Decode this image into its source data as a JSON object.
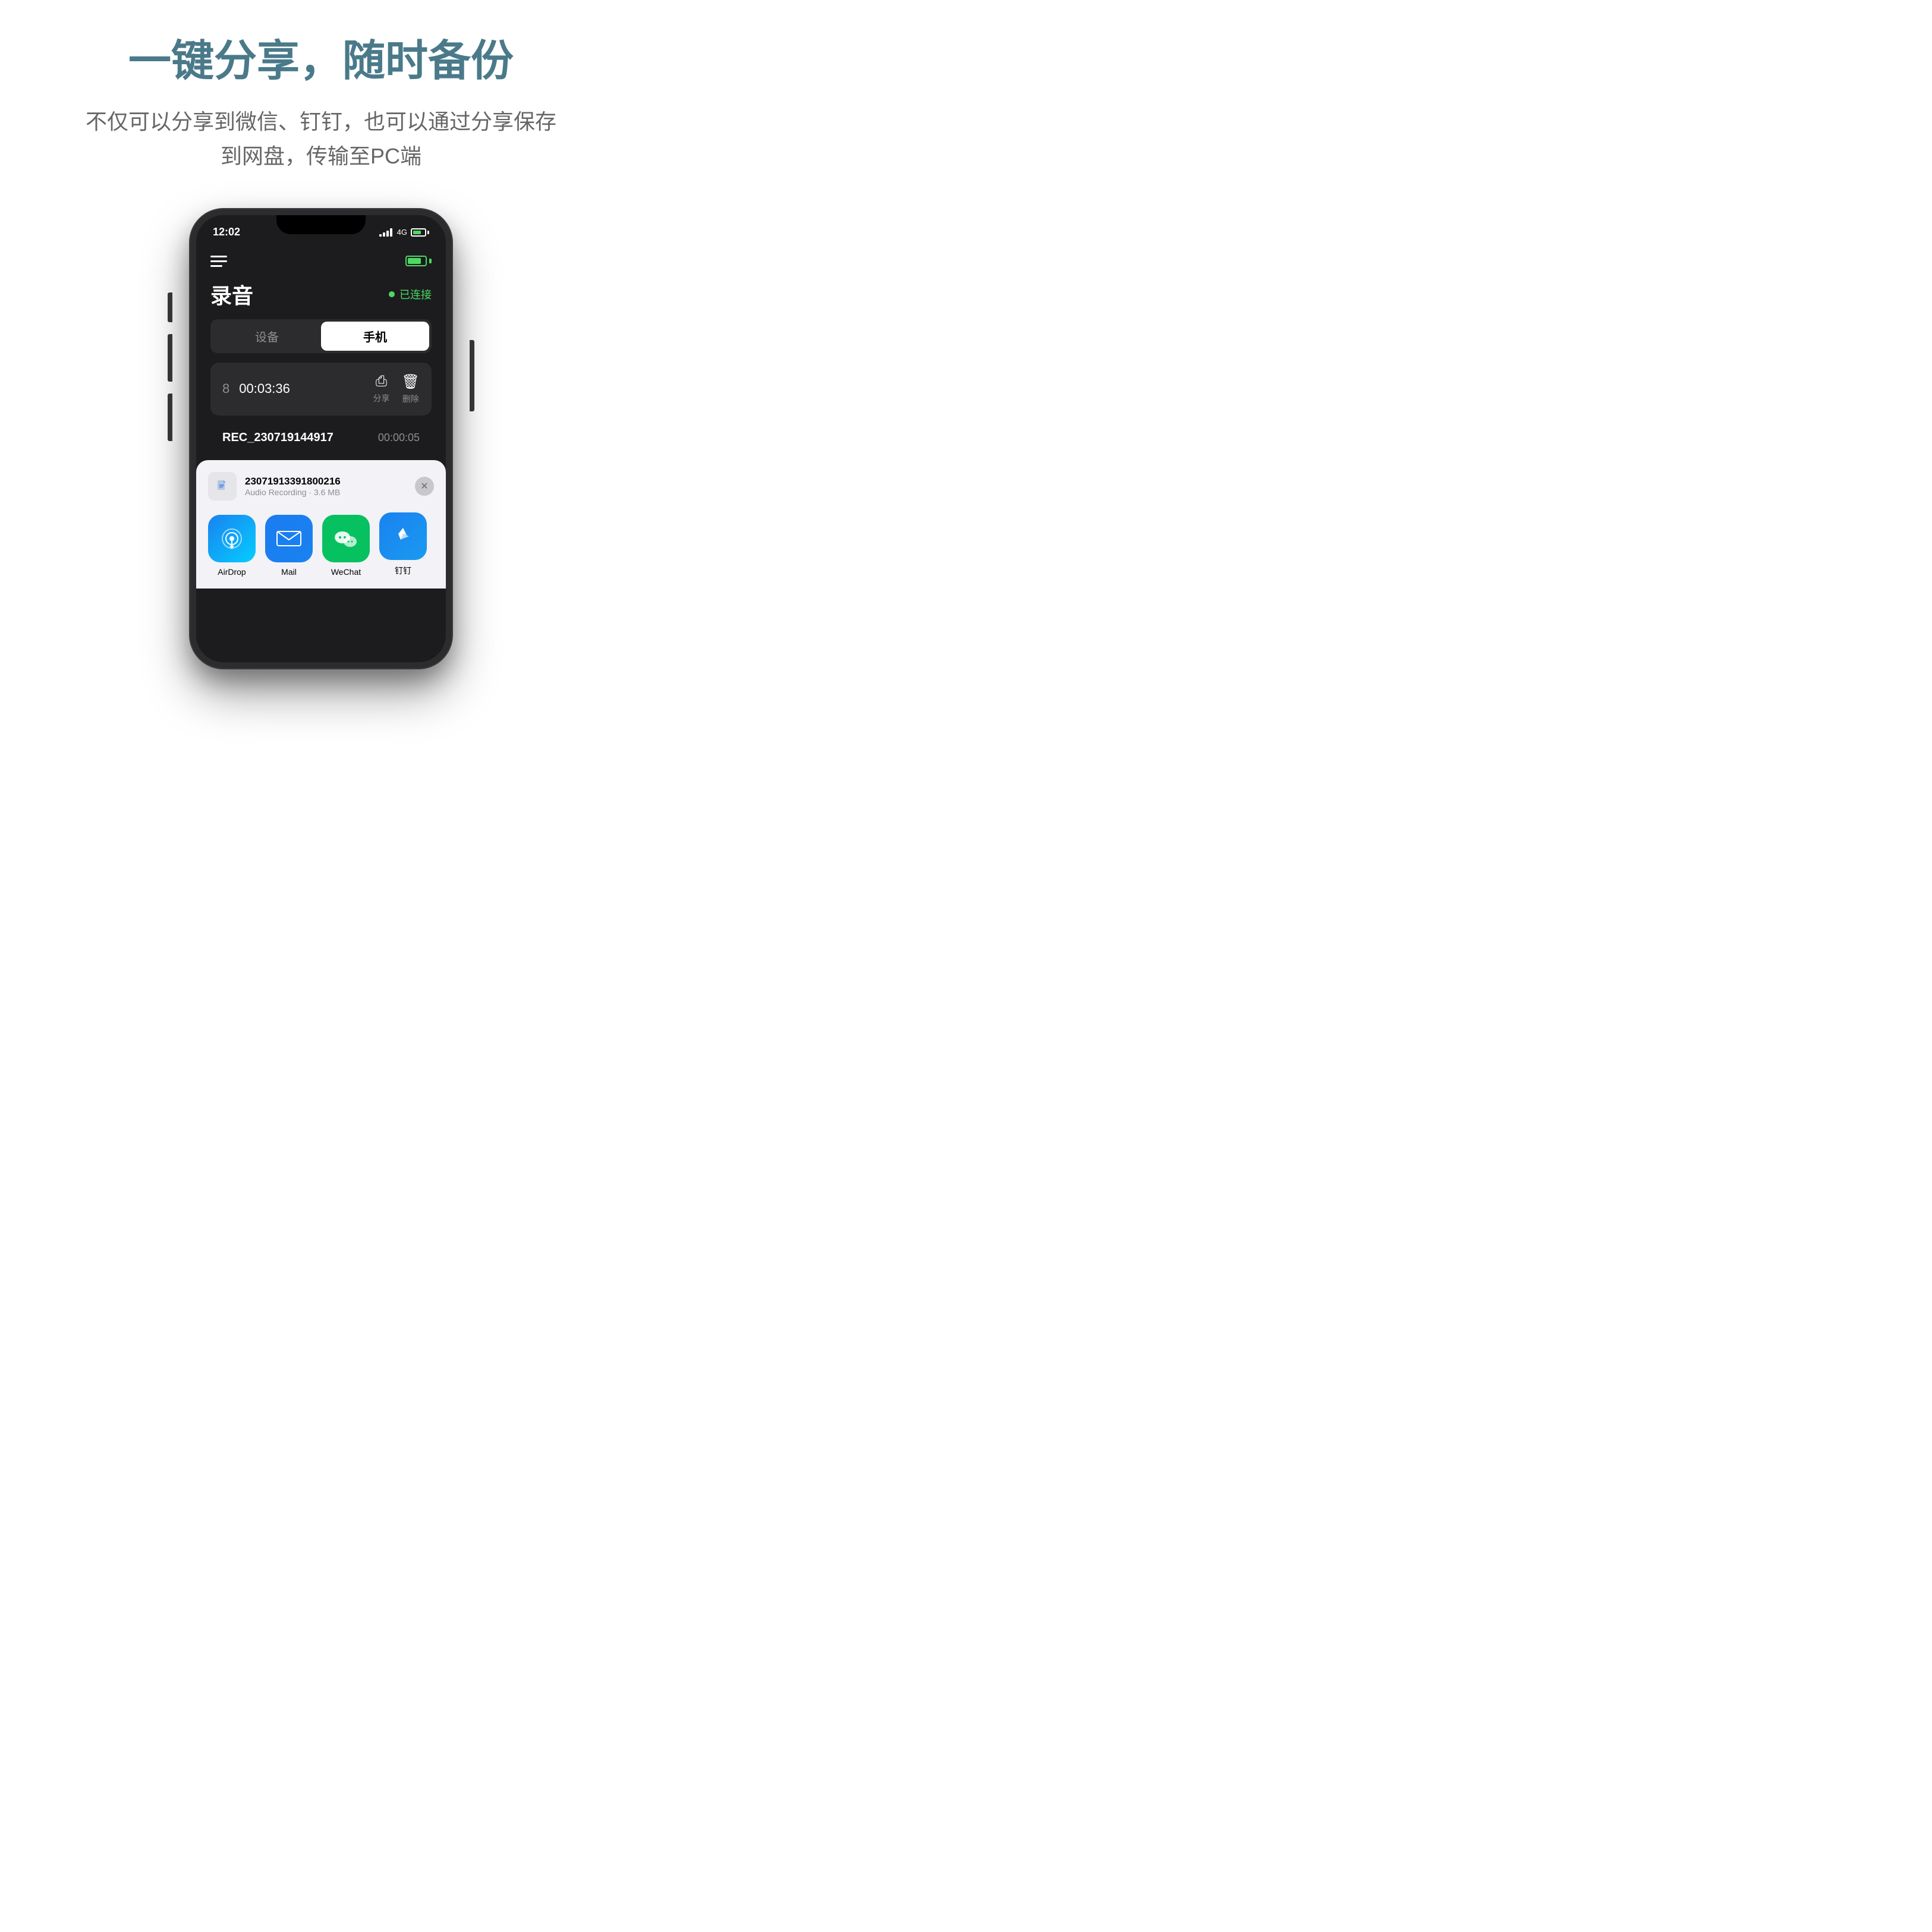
{
  "page": {
    "title": "一键分享，随时备份",
    "subtitle": "不仅可以分享到微信、钉钉，也可以通过分享保存到网盘，传输至PC端"
  },
  "phone": {
    "status_bar": {
      "time": "12:02",
      "network": "4G"
    },
    "app": {
      "title": "录音",
      "connection_label": "已连接",
      "tabs": [
        {
          "label": "设备",
          "active": false
        },
        {
          "label": "手机",
          "active": true
        }
      ],
      "recording_item": {
        "number": "8",
        "duration": "00:03:36",
        "share_label": "分享",
        "delete_label": "删除"
      },
      "recording_row2": {
        "name": "REC_230719144917",
        "duration": "00:00:05"
      }
    },
    "share_sheet": {
      "file_name": "23071913391800216",
      "file_meta": "Audio Recording · 3.6 MB",
      "apps": [
        {
          "label": "AirDrop",
          "type": "airdrop"
        },
        {
          "label": "Mail",
          "type": "mail"
        },
        {
          "label": "WeChat",
          "type": "wechat"
        },
        {
          "label": "钉钉",
          "type": "dingding"
        }
      ]
    }
  }
}
